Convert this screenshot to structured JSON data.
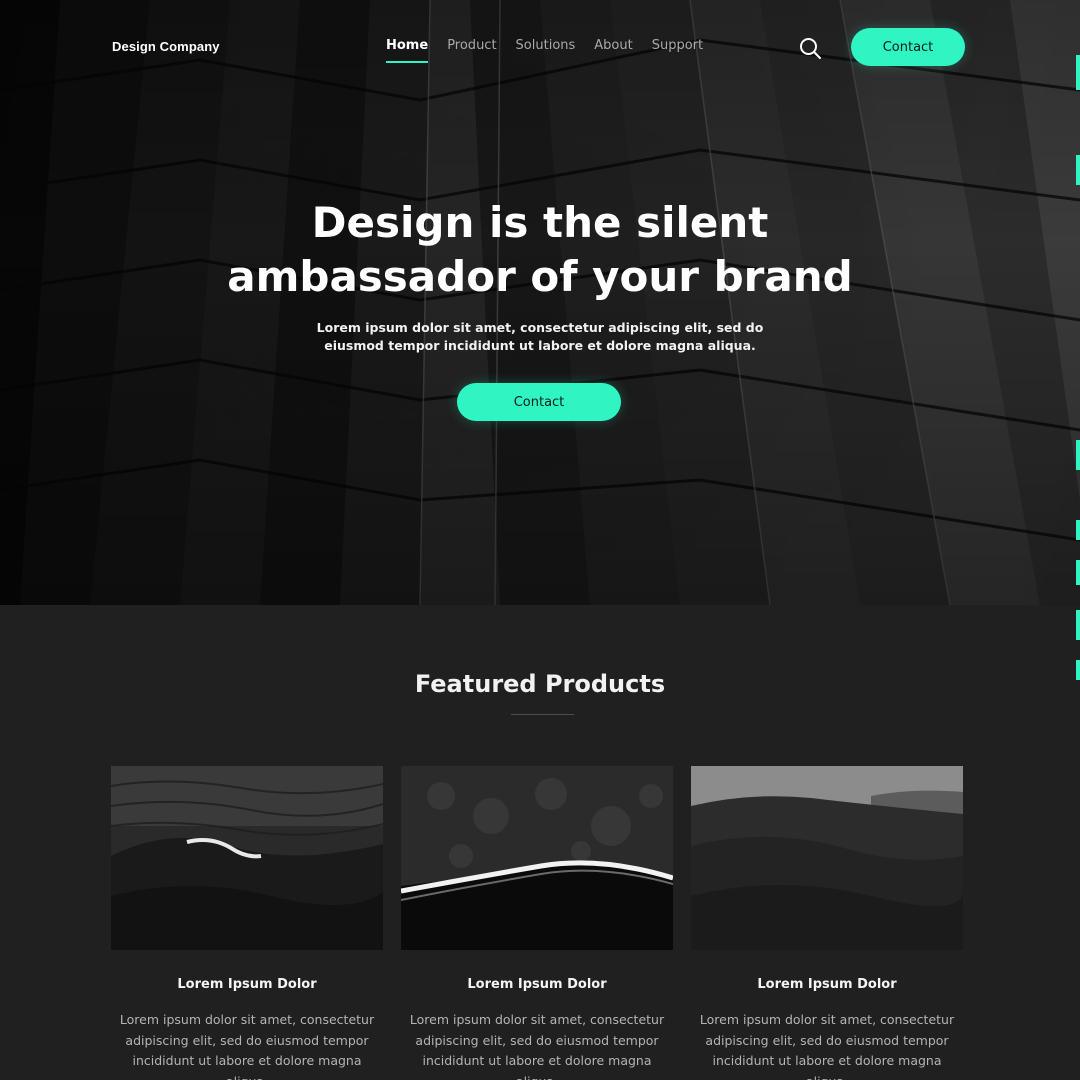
{
  "brand": "Design Company",
  "nav": {
    "items": [
      {
        "label": "Home",
        "active": true
      },
      {
        "label": "Product",
        "active": false
      },
      {
        "label": "Solutions",
        "active": false
      },
      {
        "label": "About",
        "active": false
      },
      {
        "label": "Support",
        "active": false
      }
    ],
    "search_icon": "search-icon",
    "contact_label": "Contact"
  },
  "hero": {
    "title_line1": "Design is the silent",
    "title_line2": "ambassador of your brand",
    "subtitle_line1": "Lorem ipsum dolor sit amet, consectetur adipiscing elit, sed do",
    "subtitle_line2": "eiusmod tempor incididunt ut labore et dolore magna aliqua.",
    "button_label": "Contact"
  },
  "featured": {
    "title": "Featured Products",
    "cards": [
      {
        "image": "ocean-wave",
        "title": "Lorem Ipsum Dolor",
        "text_line1": "Lorem ipsum dolor sit amet, consectetur",
        "text_line2": "adipiscing elit, sed do eiusmod tempor",
        "text_line3": "incididunt ut labore et dolore magna aliqua."
      },
      {
        "image": "aerial-shoreline",
        "title": "Lorem Ipsum Dolor",
        "text_line1": "Lorem ipsum dolor sit amet, consectetur",
        "text_line2": "adipiscing elit, sed do eiusmod tempor",
        "text_line3": "incididunt ut labore et dolore magna aliqua."
      },
      {
        "image": "sand-dunes",
        "title": "Lorem Ipsum Dolor",
        "text_line1": "Lorem ipsum dolor sit amet, consectetur",
        "text_line2": "adipiscing elit, sed do eiusmod tempor",
        "text_line3": "incididunt ut labore et dolore magna aliqua."
      }
    ]
  },
  "colors": {
    "accent": "#2ff5c3",
    "background": "#202020"
  }
}
